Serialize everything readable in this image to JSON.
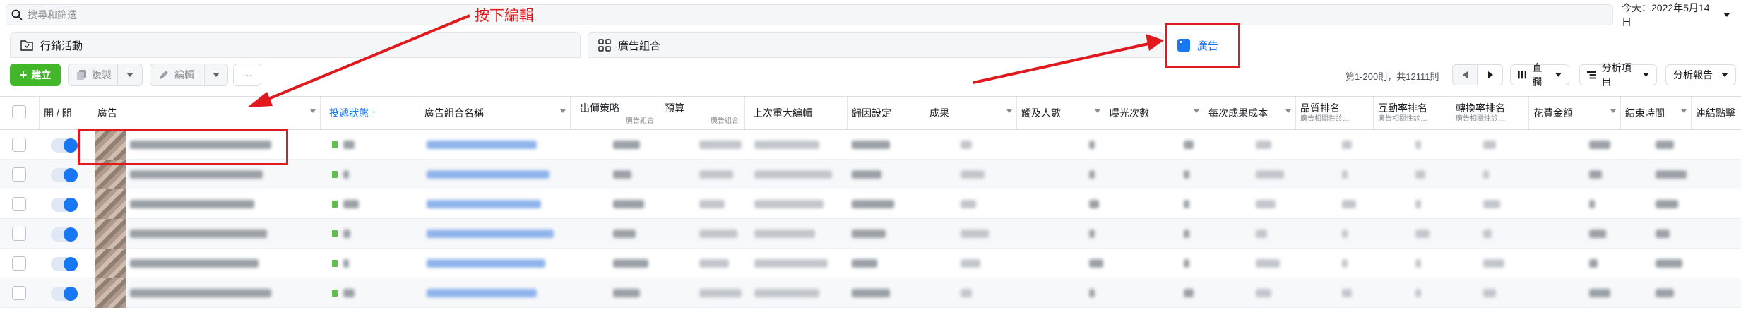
{
  "search": {
    "placeholder": "搜尋和篩選"
  },
  "date": {
    "label": "今天：2022年5月14日"
  },
  "level_tabs": {
    "campaign": "行銷活動",
    "adset": "廣告組合",
    "ad": "廣告"
  },
  "toolbar": {
    "create": "建立",
    "copy": "複製",
    "edit": "編輯",
    "more": "···",
    "pagination": "第1-200則，共12111則",
    "columns": "直欄",
    "breakdown": "分析項目",
    "reports": "分析報告"
  },
  "table": {
    "columns": [
      {
        "label": "開 / 關",
        "sub": ""
      },
      {
        "label": "廣告",
        "sub": ""
      },
      {
        "label": "投遞狀態 ↑",
        "sub": ""
      },
      {
        "label": "廣告組合名稱",
        "sub": ""
      },
      {
        "label": "出價策略",
        "sub": "廣告組合"
      },
      {
        "label": "預算",
        "sub": "廣告組合"
      },
      {
        "label": "上次重大編輯",
        "sub": ""
      },
      {
        "label": "歸因設定",
        "sub": ""
      },
      {
        "label": "成果",
        "sub": ""
      },
      {
        "label": "觸及人數",
        "sub": ""
      },
      {
        "label": "曝光次數",
        "sub": ""
      },
      {
        "label": "每次成果成本",
        "sub": ""
      },
      {
        "label": "品質排名",
        "sub": "廣告相關性診…"
      },
      {
        "label": "互動率排名",
        "sub": "廣告相關性診…"
      },
      {
        "label": "轉換率排名",
        "sub": "廣告相關性診…"
      },
      {
        "label": "花費金額",
        "sub": ""
      },
      {
        "label": "結束時間",
        "sub": ""
      },
      {
        "label": "連結點擊",
        "sub": ""
      }
    ],
    "row_count_visible": 6
  },
  "annotation": {
    "text": "按下編輯"
  },
  "colors": {
    "accent": "#1877f2",
    "create": "#42b72a",
    "annotation": "#e0191e"
  },
  "icons": [
    "search-icon",
    "folder-icon",
    "grid-icon",
    "ad-icon",
    "copy-icon",
    "pencil-icon",
    "chevron-left-icon",
    "chevron-right-icon",
    "columns-icon",
    "breakdown-icon"
  ]
}
